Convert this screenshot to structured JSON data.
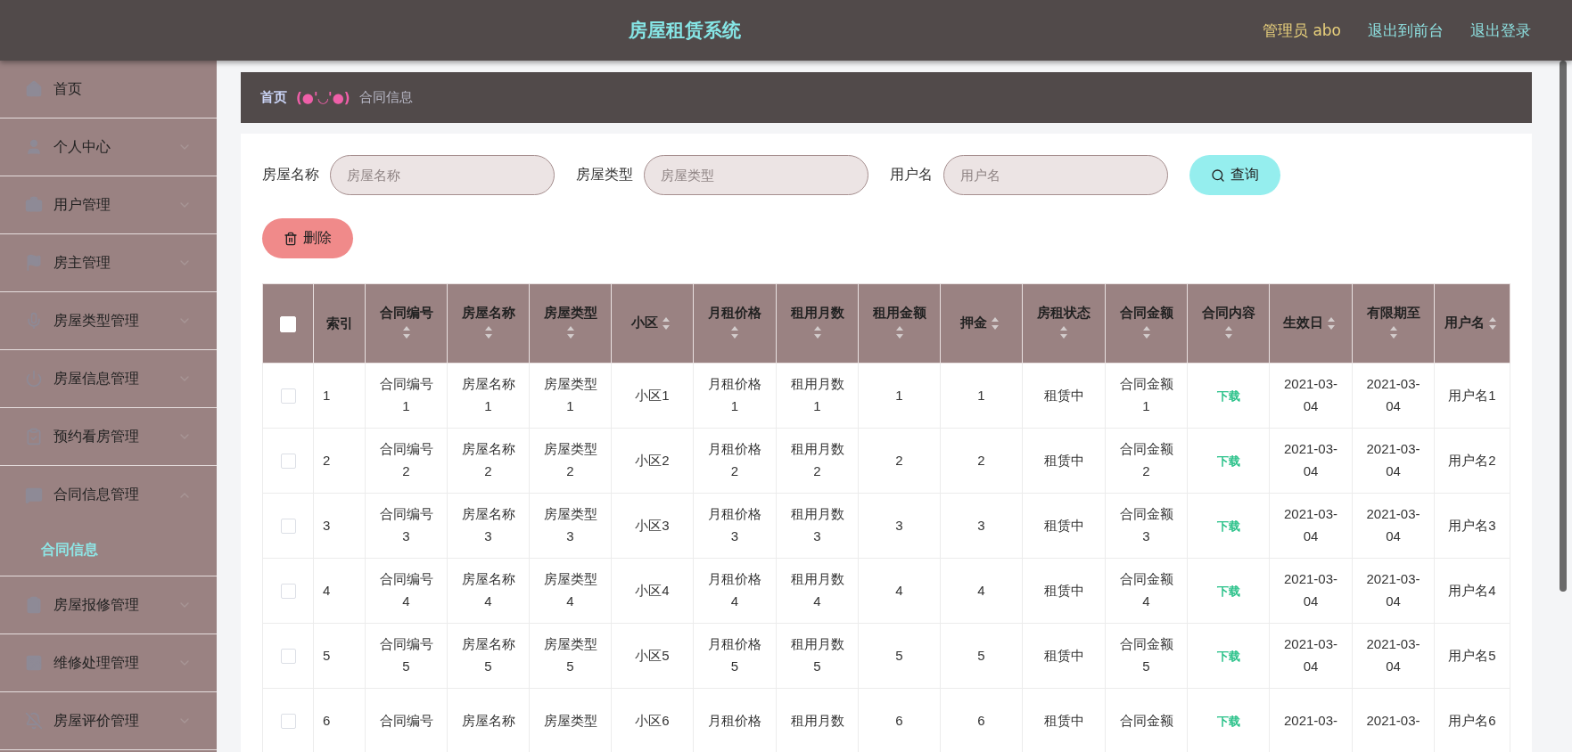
{
  "header": {
    "title": "房屋租赁系统",
    "user": "管理员 abo",
    "links": [
      "退出到前台",
      "退出登录"
    ]
  },
  "sidebar": {
    "items": [
      {
        "label": "首页"
      },
      {
        "label": "个人中心",
        "expanded": false
      },
      {
        "label": "用户管理",
        "expanded": false
      },
      {
        "label": "房主管理",
        "expanded": false
      },
      {
        "label": "房屋类型管理",
        "expanded": false
      },
      {
        "label": "房屋信息管理",
        "expanded": false
      },
      {
        "label": "预约看房管理",
        "expanded": false
      },
      {
        "label": "合同信息管理",
        "expanded": true,
        "children": [
          {
            "label": "合同信息",
            "selected": true
          }
        ]
      },
      {
        "label": "房屋报修管理",
        "expanded": false
      },
      {
        "label": "维修处理管理",
        "expanded": false
      },
      {
        "label": "房屋评价管理",
        "expanded": false
      }
    ]
  },
  "breadcrumb": {
    "home": "首页",
    "separator": "(●'◡'●)",
    "current": "合同信息"
  },
  "search": {
    "fields": [
      {
        "label": "房屋名称",
        "placeholder": "房屋名称"
      },
      {
        "label": "房屋类型",
        "placeholder": "房屋类型"
      },
      {
        "label": "用户名",
        "placeholder": "用户名"
      }
    ],
    "button": "查询"
  },
  "delete_button": "删除",
  "table": {
    "select_all": {
      "checked": false
    },
    "columns": [
      {
        "kind": "checkbox"
      },
      {
        "kind": "text",
        "label": "索引",
        "sortable": false
      },
      {
        "kind": "text",
        "label": "合同编号",
        "sortable": true
      },
      {
        "kind": "text",
        "label": "房屋名称",
        "sortable": true
      },
      {
        "kind": "text",
        "label": "房屋类型",
        "sortable": true
      },
      {
        "kind": "text",
        "label": "小区",
        "sortable": true
      },
      {
        "kind": "text",
        "label": "月租价格",
        "sortable": true
      },
      {
        "kind": "text",
        "label": "租用月数",
        "sortable": true
      },
      {
        "kind": "text",
        "label": "租用金额",
        "sortable": true
      },
      {
        "kind": "text",
        "label": "押金",
        "sortable": true
      },
      {
        "kind": "text",
        "label": "房租状态",
        "sortable": true
      },
      {
        "kind": "text",
        "label": "合同金额",
        "sortable": true
      },
      {
        "kind": "link",
        "label": "合同内容",
        "sortable": true
      },
      {
        "kind": "text",
        "label": "生效日",
        "sortable": true
      },
      {
        "kind": "text",
        "label": "有限期至",
        "sortable": true
      },
      {
        "kind": "text",
        "label": "用户名",
        "sortable": true
      }
    ],
    "rows": [
      {
        "checked": false,
        "cells": [
          "",
          "1",
          "合同编号1",
          "房屋名称1",
          "房屋类型1",
          "小区1",
          "月租价格1",
          "租用月数1",
          "1",
          "1",
          "租赁中",
          "合同金额1",
          "下载",
          "2021-03-04",
          "2021-03-04",
          "用户名1"
        ]
      },
      {
        "checked": false,
        "cells": [
          "",
          "2",
          "合同编号2",
          "房屋名称2",
          "房屋类型2",
          "小区2",
          "月租价格2",
          "租用月数2",
          "2",
          "2",
          "租赁中",
          "合同金额2",
          "下载",
          "2021-03-04",
          "2021-03-04",
          "用户名2"
        ]
      },
      {
        "checked": false,
        "cells": [
          "",
          "3",
          "合同编号3",
          "房屋名称3",
          "房屋类型3",
          "小区3",
          "月租价格3",
          "租用月数3",
          "3",
          "3",
          "租赁中",
          "合同金额3",
          "下载",
          "2021-03-04",
          "2021-03-04",
          "用户名3"
        ]
      },
      {
        "checked": false,
        "cells": [
          "",
          "4",
          "合同编号4",
          "房屋名称4",
          "房屋类型4",
          "小区4",
          "月租价格4",
          "租用月数4",
          "4",
          "4",
          "租赁中",
          "合同金额4",
          "下载",
          "2021-03-04",
          "2021-03-04",
          "用户名4"
        ]
      },
      {
        "checked": false,
        "cells": [
          "",
          "5",
          "合同编号5",
          "房屋名称5",
          "房屋类型5",
          "小区5",
          "月租价格5",
          "租用月数5",
          "5",
          "5",
          "租赁中",
          "合同金额5",
          "下载",
          "2021-03-04",
          "2021-03-04",
          "用户名5"
        ]
      },
      {
        "checked": false,
        "cells": [
          "",
          "6",
          "合同编号",
          "房屋名称",
          "房屋类型",
          "小区6",
          "月租价格",
          "租用月数",
          "6",
          "6",
          "租赁中",
          "合同金额",
          "下载",
          "2021-03-",
          "2021-03-",
          "用户名6"
        ]
      }
    ]
  }
}
